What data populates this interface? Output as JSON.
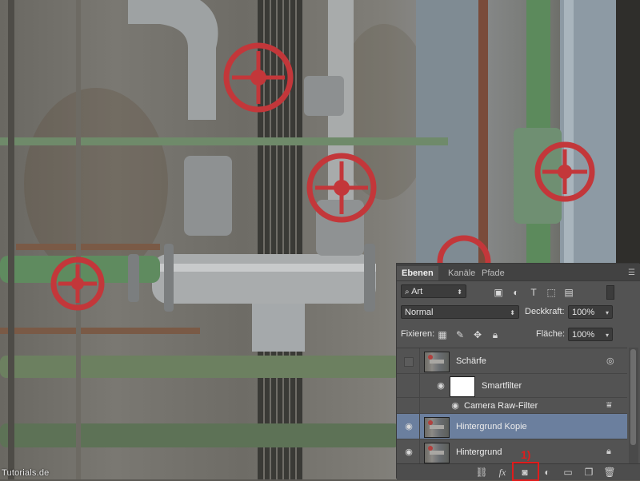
{
  "photo": {
    "watermark": "Tutorials.de"
  },
  "panel": {
    "tabs": [
      {
        "label": "Ebenen",
        "active": true
      },
      {
        "label": "Kanäle",
        "active": false
      },
      {
        "label": "Pfade",
        "active": false
      }
    ],
    "filter": {
      "value": "Art"
    },
    "blend_mode": {
      "value": "Normal"
    },
    "opacity": {
      "label": "Deckkraft:",
      "value": "100%"
    },
    "lock": {
      "label": "Fixieren:"
    },
    "fill": {
      "label": "Fläche:",
      "value": "100%"
    },
    "layers": [
      {
        "name": "Schärfe",
        "visible": false,
        "selected": false
      },
      {
        "name": "Smartfilter",
        "visible": true,
        "selected": false
      },
      {
        "name": "Camera Raw-Filter",
        "visible": true,
        "selected": false
      },
      {
        "name": "Hintergrund Kopie",
        "visible": true,
        "selected": true
      },
      {
        "name": "Hintergrund",
        "visible": true,
        "selected": false,
        "locked": true
      }
    ],
    "bottom": {
      "fx_label": "fx",
      "annotation": "1)"
    }
  },
  "colors": {
    "selection": "#6b7f9e",
    "panel": "#535353",
    "annotation_red": "#e01c1c",
    "valve_red": "#c3373a"
  }
}
